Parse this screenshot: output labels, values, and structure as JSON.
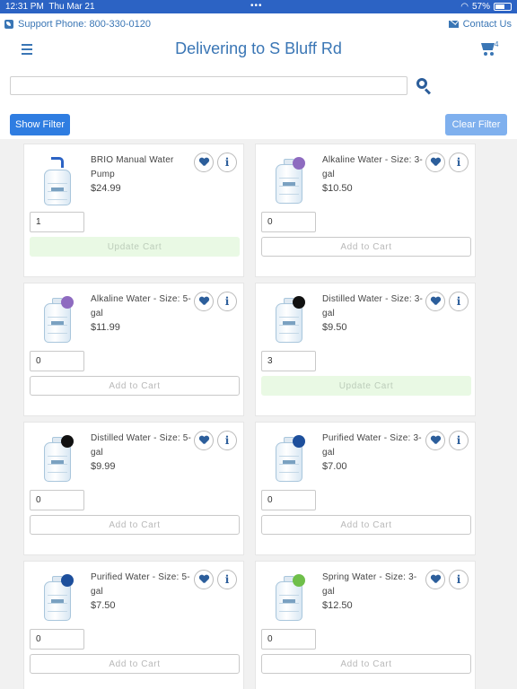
{
  "status_bar": {
    "time": "12:31 PM",
    "date": "Thu Mar 21",
    "dots": "•••",
    "battery": "57%"
  },
  "top": {
    "support_text": "Support Phone: 800-330-0120",
    "contact_text": "Contact Us"
  },
  "header": {
    "title": "Delivering to S Bluff Rd",
    "cart_count": "4"
  },
  "search": {
    "value": "",
    "placeholder": ""
  },
  "filters": {
    "show_label": "Show Filter",
    "clear_label": "Clear Filter"
  },
  "colors": {
    "brand": "#3a76b5",
    "button_primary": "#2f7de1",
    "button_light": "#7fb0ee",
    "update_bg": "#e9f9e4"
  },
  "products": [
    {
      "name": "BRIO Manual Water Pump",
      "price": "$24.99",
      "qty": "1",
      "action": "Update Cart",
      "action_type": "update",
      "image": "pump",
      "badge": ""
    },
    {
      "name": "Alkaline Water - Size: 3-gal",
      "price": "$10.50",
      "qty": "0",
      "action": "Add to Cart",
      "action_type": "add",
      "image": "bottle",
      "badge": "#8e6bc0"
    },
    {
      "name": "Alkaline Water - Size: 5-gal",
      "price": "$11.99",
      "qty": "0",
      "action": "Add to Cart",
      "action_type": "add",
      "image": "bottle",
      "badge": "#8e6bc0"
    },
    {
      "name": "Distilled Water - Size: 3-gal",
      "price": "$9.50",
      "qty": "3",
      "action": "Update Cart",
      "action_type": "update",
      "image": "bottle",
      "badge": "#111111"
    },
    {
      "name": "Distilled Water - Size: 5-gal",
      "price": "$9.99",
      "qty": "0",
      "action": "Add to Cart",
      "action_type": "add",
      "image": "bottle",
      "badge": "#111111"
    },
    {
      "name": "Purified Water - Size: 3-gal",
      "price": "$7.00",
      "qty": "0",
      "action": "Add to Cart",
      "action_type": "add",
      "image": "bottle",
      "badge": "#1d4f9c"
    },
    {
      "name": "Purified Water - Size: 5-gal",
      "price": "$7.50",
      "qty": "0",
      "action": "Add to Cart",
      "action_type": "add",
      "image": "bottle",
      "badge": "#1d4f9c"
    },
    {
      "name": "Spring Water - Size: 3-gal",
      "price": "$12.50",
      "qty": "0",
      "action": "Add to Cart",
      "action_type": "add",
      "image": "bottle",
      "badge": "#6fbf4a"
    }
  ]
}
